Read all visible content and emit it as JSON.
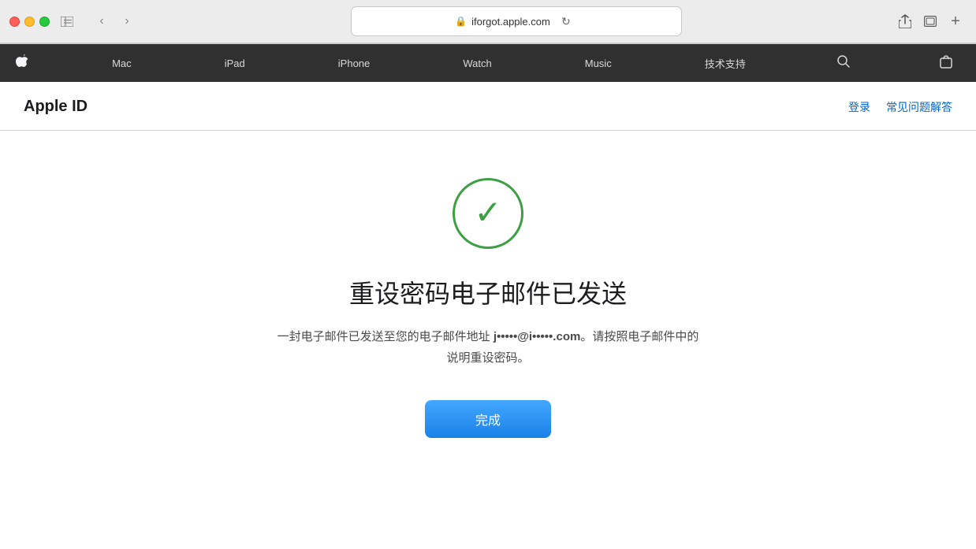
{
  "browser": {
    "url": "iforgot.apple.com",
    "lock_symbol": "🔒",
    "reload_symbol": "↻",
    "back_symbol": "‹",
    "forward_symbol": "›",
    "sidebar_symbol": "⊡",
    "share_symbol": "⬆",
    "new_tab_symbol": "+"
  },
  "nav": {
    "apple_logo": "",
    "items": [
      {
        "label": "Mac"
      },
      {
        "label": "iPad"
      },
      {
        "label": "iPhone"
      },
      {
        "label": "Watch"
      },
      {
        "label": "Music"
      },
      {
        "label": "技术支持"
      }
    ]
  },
  "header": {
    "title": "Apple ID",
    "links": [
      {
        "label": "登录"
      },
      {
        "label": "常见问题解答"
      }
    ]
  },
  "main": {
    "success_title": "重设密码电子邮件已发送",
    "success_desc_part1": "一封电子邮件已发送至您的电子邮件地址 ",
    "email": "j•••••@i•••••.com",
    "success_desc_part2": "。请按照电子邮件中的说明重设密码。",
    "done_button_label": "完成"
  }
}
